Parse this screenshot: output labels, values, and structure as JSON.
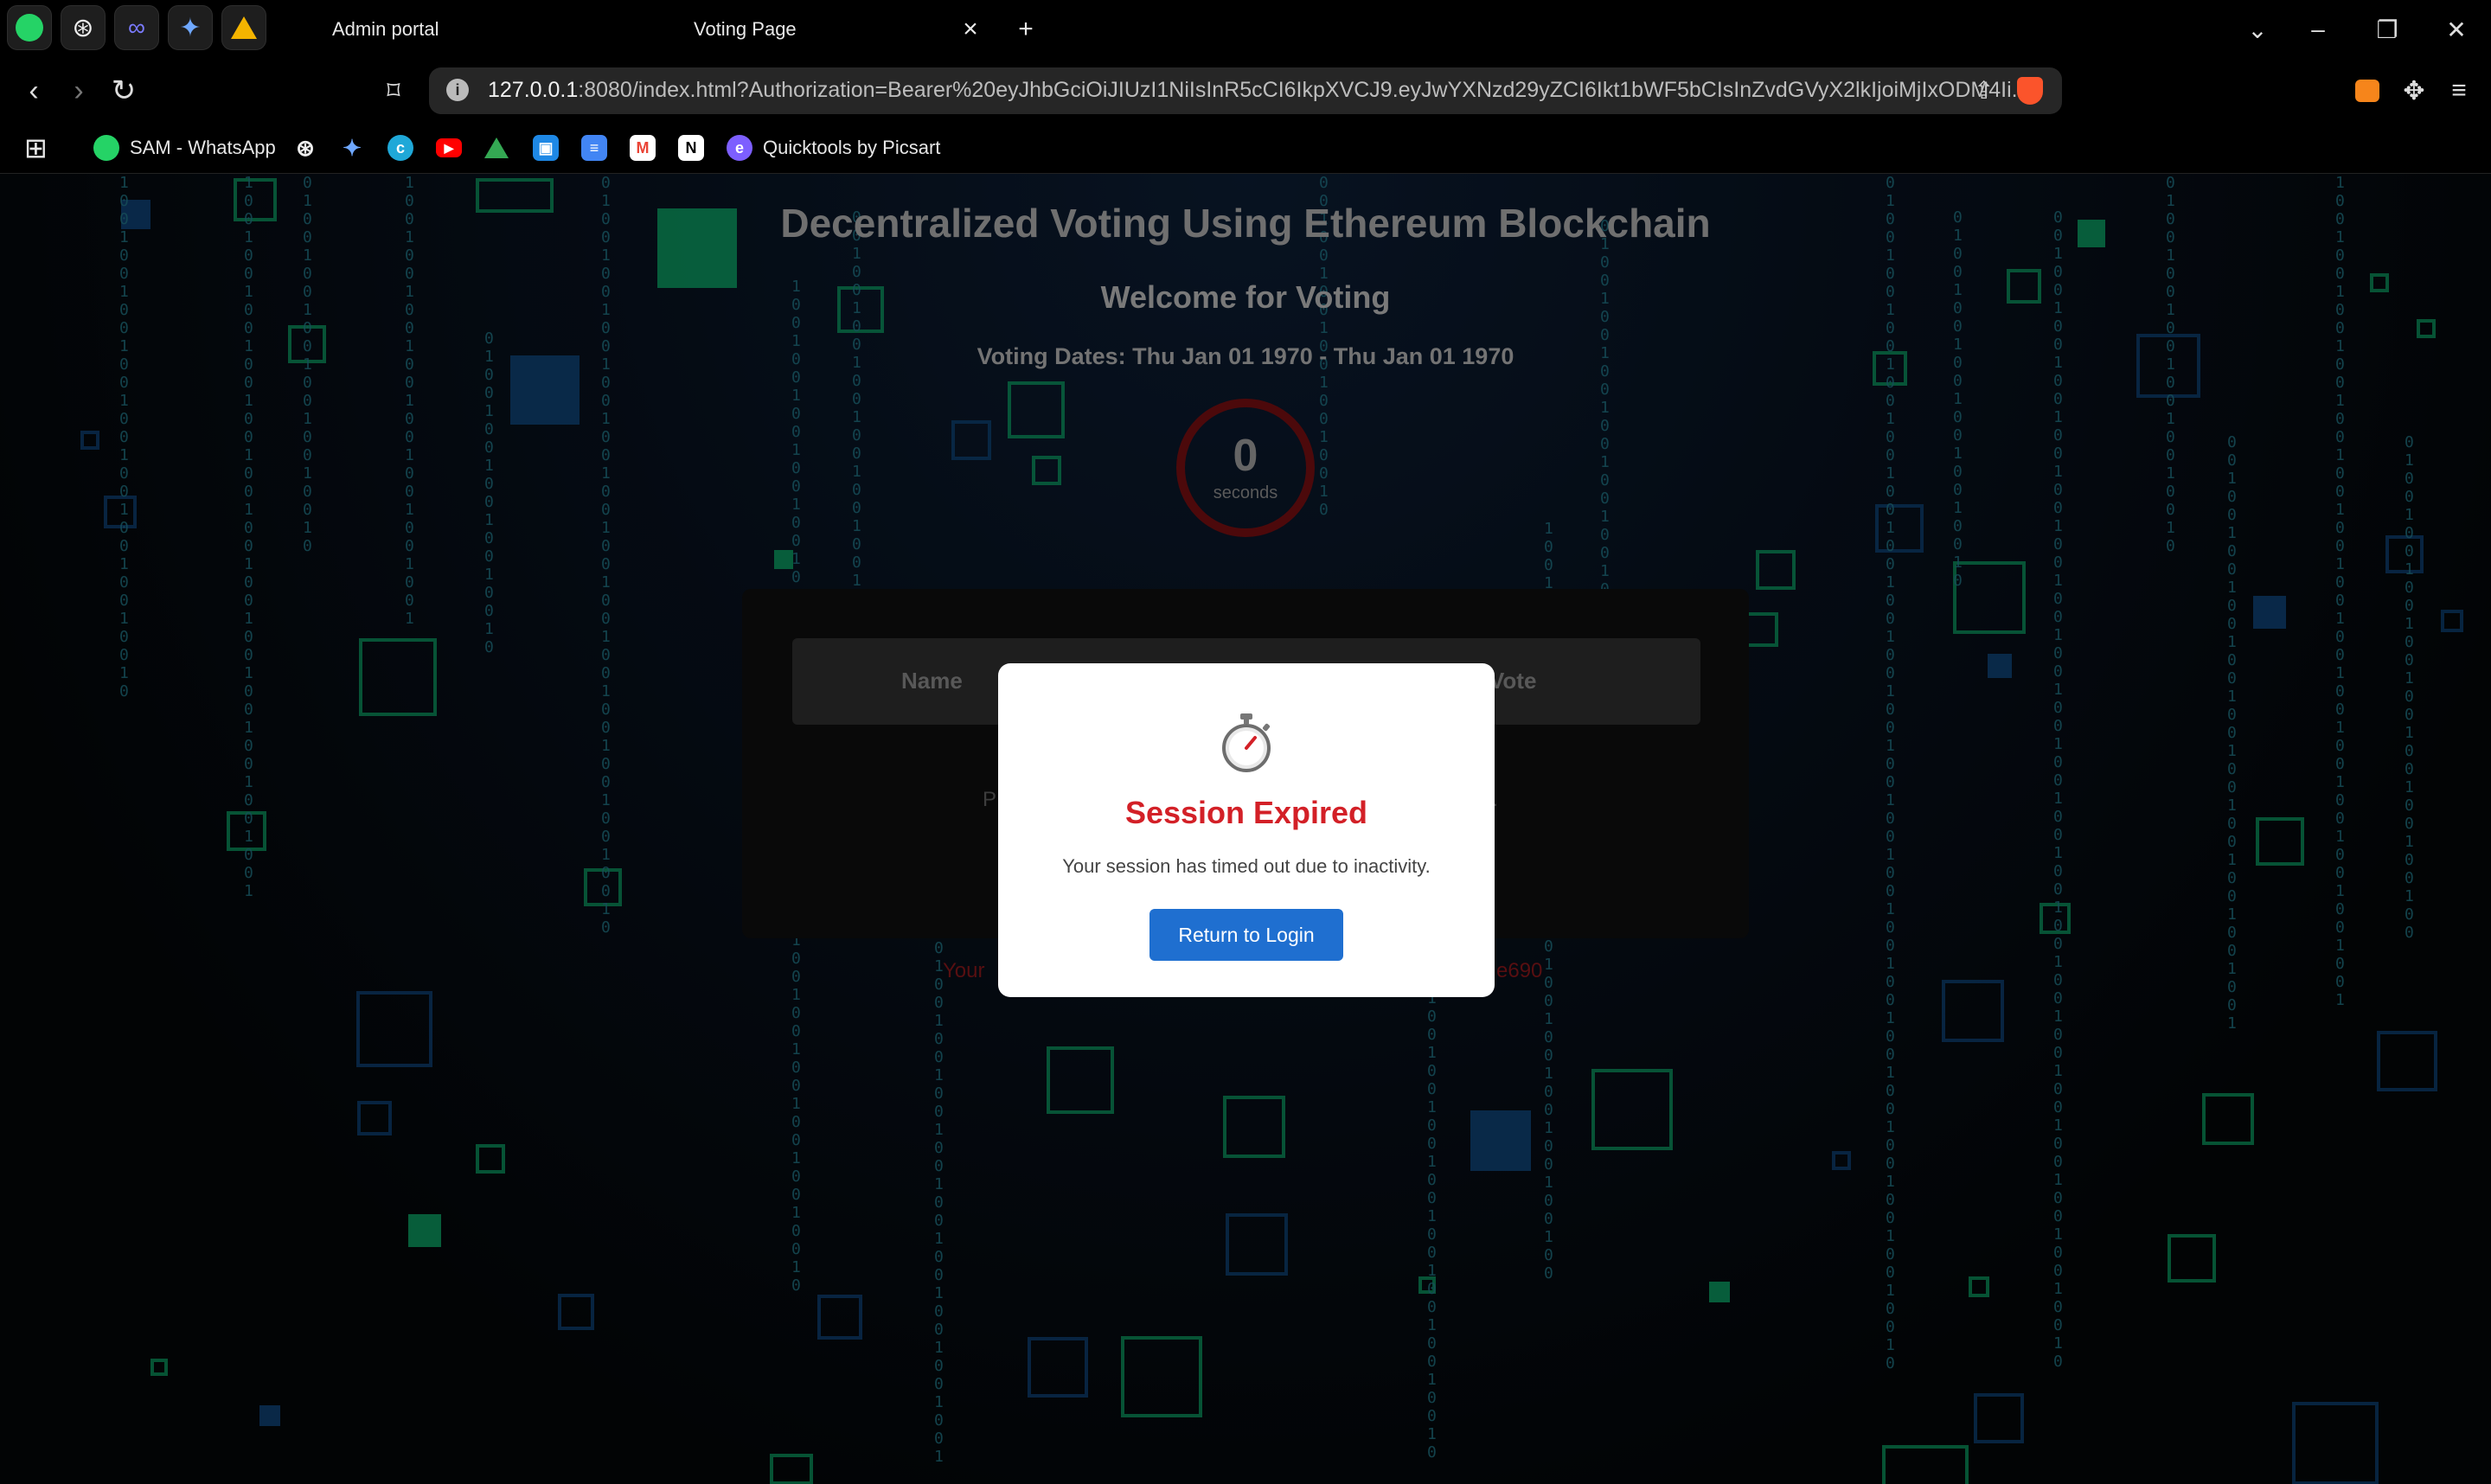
{
  "browser": {
    "tabs": [
      {
        "title": "Admin portal",
        "active": false
      },
      {
        "title": "Voting Page",
        "active": true
      }
    ],
    "new_tab_icon": "plus-icon",
    "url_host": "127.0.0.1",
    "url_rest": ":8080/index.html?Authorization=Bearer%20eyJhbGciOiJIUzI1NiIsInR5cCI6IkpXVCJ9.eyJwYXNzd29yZCI6Ikt1bWF5bCIsInZvdGVyX2lkIjoiMjIxODM4Ii...",
    "bookmarks": [
      {
        "label": "SAM - WhatsApp",
        "icon": "whatsapp-icon"
      },
      {
        "label": "",
        "icon": "chatgpt-icon"
      },
      {
        "label": "",
        "icon": "gemini-icon"
      },
      {
        "label": "",
        "icon": "canva-icon"
      },
      {
        "label": "",
        "icon": "youtube-icon"
      },
      {
        "label": "",
        "icon": "google-drive-icon"
      },
      {
        "label": "",
        "icon": "google-classroom-icon"
      },
      {
        "label": "",
        "icon": "google-docs-icon"
      },
      {
        "label": "",
        "icon": "gmail-icon"
      },
      {
        "label": "",
        "icon": "notion-icon"
      },
      {
        "label": "Quicktools by Picsart",
        "icon": "picsart-icon"
      }
    ]
  },
  "page": {
    "title": "Decentralized Voting Using Ethereum Blockchain",
    "welcome": "Welcome for Voting",
    "voting_dates": "Voting Dates: Thu Jan 01 1970 - Thu Jan 01 1970",
    "timer": {
      "value": "0",
      "unit": "seconds"
    },
    "table_headers": [
      "Name",
      "Vote"
    ],
    "faint_left": "P",
    "faint_right": "n.",
    "account_left": "Your",
    "account_right": "e690"
  },
  "modal": {
    "icon": "stopwatch-icon",
    "title": "Session Expired",
    "message": "Your session has timed out due to inactivity.",
    "button": "Return to Login"
  },
  "colors": {
    "accent_green": "#0b8f5a",
    "accent_blue": "#0e3e6e",
    "error_red": "#d32027",
    "button_blue": "#1f6fd0"
  }
}
